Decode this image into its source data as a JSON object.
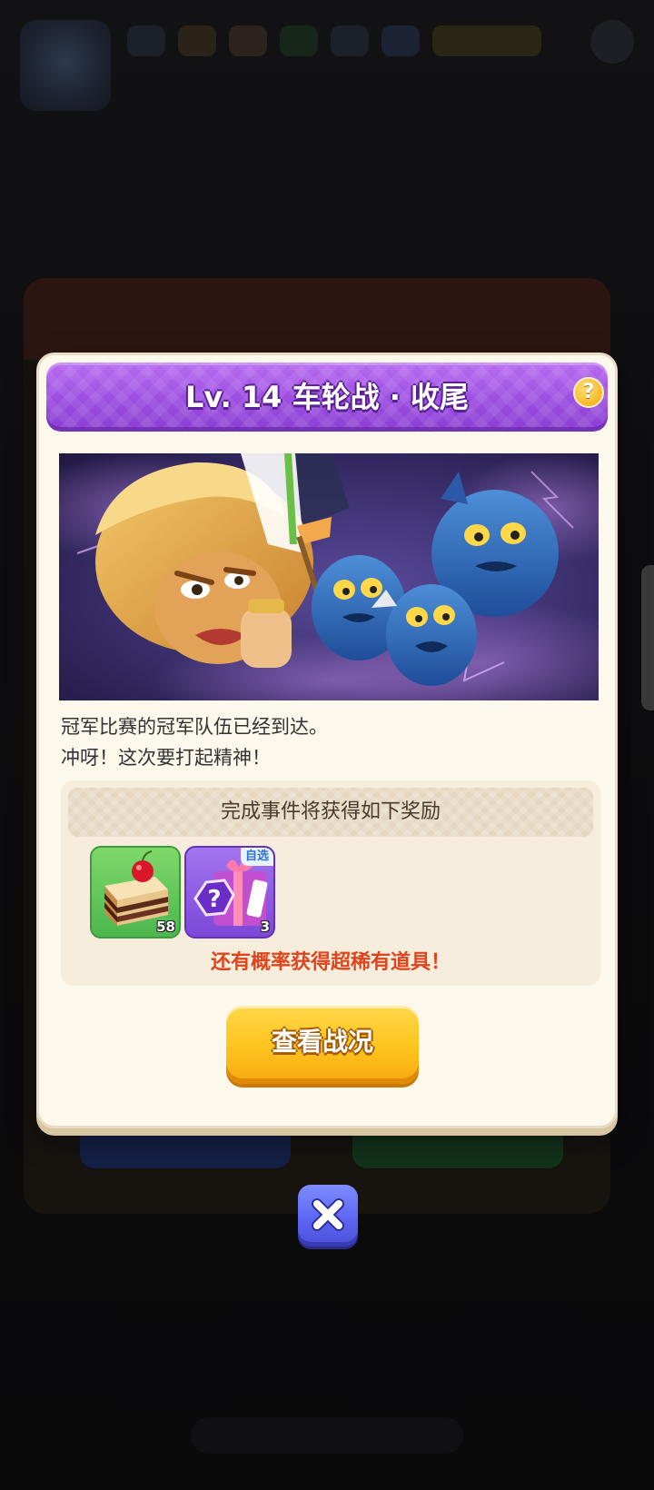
{
  "dialog": {
    "title": "Lv. 14 车轮战 · 收尾",
    "help_label": "?",
    "description_lines": [
      "冠军比赛的冠军队伍已经到达。",
      "冲呀！这次要打起精神！"
    ],
    "rewards": {
      "heading": "完成事件将获得如下奖励",
      "items": [
        {
          "name": "cake",
          "count": "58"
        },
        {
          "name": "choice-mystery-gift",
          "tag": "自选",
          "count": "3"
        }
      ],
      "rare_note": "还有概率获得超稀有道具！"
    },
    "primary_button": "查看战况"
  },
  "colors": {
    "header_purple": "#9b4de0",
    "button_yellow": "#ffc521",
    "rare_note_red": "#e0441c",
    "close_blue": "#5d66f2"
  }
}
